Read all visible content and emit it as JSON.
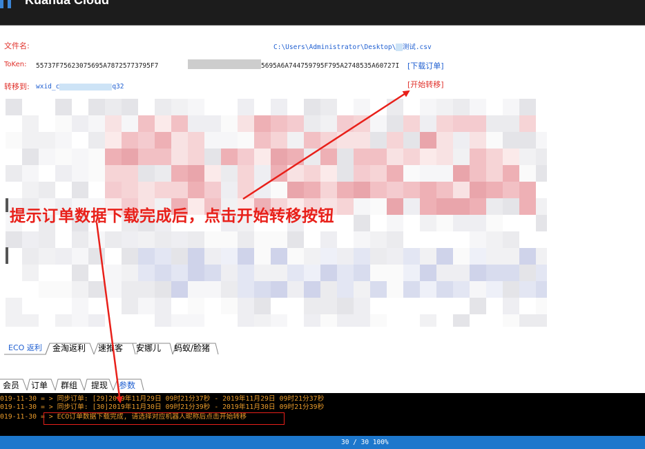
{
  "window": {
    "title": "Kuanua Cloud"
  },
  "form": {
    "file_label": "文件名:",
    "file_path_pre": "C:\\Users\\Administrator\\Desktop\\",
    "file_path_mid": "易",
    "file_path_post": "测试.csv",
    "token_label": "ToKen:",
    "token_value_a": "55737F75623075695A78725773795F7",
    "token_value_b": "5695A6A744759795F795A2748535A60727I",
    "download_link": "[下载订单]",
    "transfer_label": "转移到:",
    "transfer_value_a": "wxid_c",
    "transfer_value_b": "q32",
    "start_link": "[开始转移]"
  },
  "annotation": {
    "text": "提示订单数据下载完成后，点击开始转移按钮",
    "color": "#e8201a"
  },
  "tabs_primary": [
    {
      "label": "ECO 返利",
      "active": true
    },
    {
      "label": "金淘返利",
      "active": false
    },
    {
      "label": "速推客",
      "active": false
    },
    {
      "label": "安娜儿",
      "active": false
    },
    {
      "label": "蚂蚁/脸猪",
      "active": false
    }
  ],
  "tabs_secondary": [
    {
      "label": "会员",
      "active": false
    },
    {
      "label": "订单",
      "active": false
    },
    {
      "label": "群组",
      "active": false
    },
    {
      "label": "提现",
      "active": false
    },
    {
      "label": "参数",
      "active": true
    }
  ],
  "console": [
    {
      "date": "019-11-30",
      "sep": " = > ",
      "text": "同步订单: [29]2019年11月29日 09时21分37秒 - 2019年11月29日 09时21分37秒"
    },
    {
      "date": "019-11-30",
      "sep": " = > ",
      "text": "同步订单: [30]2019年11月30日 09时21分39秒 - 2019年11月30日 09时21分39秒"
    },
    {
      "date": "019-11-30",
      "sep": " = > ",
      "text": "ECO订单数据下载完成, 请选择对应机器人昵称后点击开始转移"
    }
  ],
  "status": {
    "text": "30 / 30  100%"
  },
  "colors": {
    "accent": "#1d77cc",
    "label_red": "#e0302a",
    "link_blue": "#1f5fd1",
    "console_text": "#e89a2a"
  }
}
